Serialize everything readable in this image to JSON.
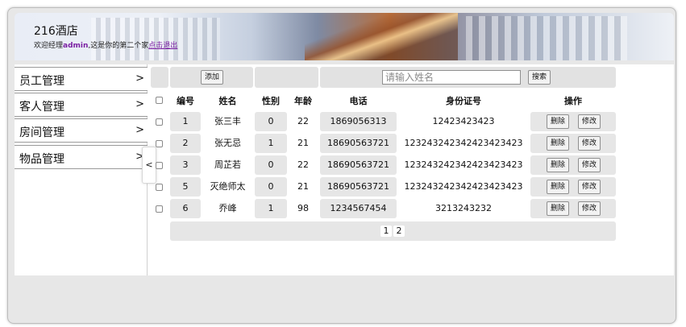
{
  "header": {
    "brand": "216酒店",
    "welcome_prefix": "欢迎经理",
    "username": "admin",
    "welcome_suffix": ",这是你的第二个家",
    "logout": "点击退出"
  },
  "sidebar": {
    "items": [
      {
        "label": "员工管理",
        "chevron": ">"
      },
      {
        "label": "客人管理",
        "chevron": ">"
      },
      {
        "label": "房间管理",
        "chevron": ">"
      },
      {
        "label": "物品管理",
        "chevron": ">"
      }
    ],
    "collapse": "<"
  },
  "toolbar": {
    "add_label": "添加",
    "search_placeholder": "请输入姓名",
    "search_value": "",
    "search_label": "搜索"
  },
  "table": {
    "columns": [
      "编号",
      "姓名",
      "性别",
      "年龄",
      "电话",
      "身份证号",
      "操作"
    ],
    "rows": [
      {
        "id": "1",
        "name": "张三丰",
        "gender": "0",
        "age": "22",
        "phone": "1869056313",
        "idcard": "12423423423"
      },
      {
        "id": "2",
        "name": "张无忌",
        "gender": "1",
        "age": "21",
        "phone": "18690563721",
        "idcard": "123243242342423423423"
      },
      {
        "id": "3",
        "name": "周芷若",
        "gender": "0",
        "age": "22",
        "phone": "18690563721",
        "idcard": "123243242342423423423"
      },
      {
        "id": "5",
        "name": "灭绝师太",
        "gender": "0",
        "age": "21",
        "phone": "18690563721",
        "idcard": "123243242342423423423"
      },
      {
        "id": "6",
        "name": "乔峰",
        "gender": "1",
        "age": "98",
        "phone": "1234567454",
        "idcard": "3213243232"
      }
    ],
    "delete_label": "删除",
    "edit_label": "修改"
  },
  "pagination": {
    "pages": [
      "1",
      "2"
    ]
  },
  "colors": {
    "frame": "#e7e7e7",
    "cell_bg": "#e6e6e6",
    "user_highlight": "#7a1fa2"
  }
}
